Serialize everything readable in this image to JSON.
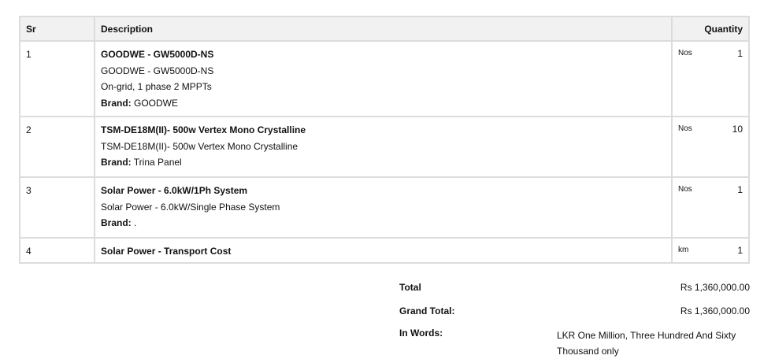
{
  "table": {
    "headers": {
      "sr": "Sr",
      "description": "Description",
      "quantity": "Quantity"
    },
    "rows": [
      {
        "sr": "1",
        "title": "GOODWE - GW5000D-NS",
        "lines": [
          "GOODWE - GW5000D-NS",
          "On-grid, 1 phase 2 MPPTs"
        ],
        "brand_label": "Brand:",
        "brand": " GOODWE",
        "unit": "Nos",
        "qty": "1"
      },
      {
        "sr": "2",
        "title": "TSM-DE18M(II)- 500w Vertex Mono Crystalline",
        "lines": [
          "TSM-DE18M(II)- 500w Vertex Mono Crystalline"
        ],
        "brand_label": "Brand:",
        "brand": " Trina Panel",
        "unit": "Nos",
        "qty": "10"
      },
      {
        "sr": "3",
        "title": "Solar Power - 6.0kW/1Ph System",
        "lines": [
          "Solar Power - 6.0kW/Single Phase System"
        ],
        "brand_label": "Brand:",
        "brand": " .",
        "unit": "Nos",
        "qty": "1"
      },
      {
        "sr": "4",
        "title": "Solar Power - Transport Cost",
        "unit": "km",
        "qty": "1"
      }
    ]
  },
  "totals": {
    "total_label": "Total",
    "total_value": "Rs 1,360,000.00",
    "grand_label": "Grand Total:",
    "grand_value": "Rs 1,360,000.00",
    "words_label": "In Words:",
    "words_value": "LKR One Million, Three Hundred And Sixty Thousand only"
  }
}
